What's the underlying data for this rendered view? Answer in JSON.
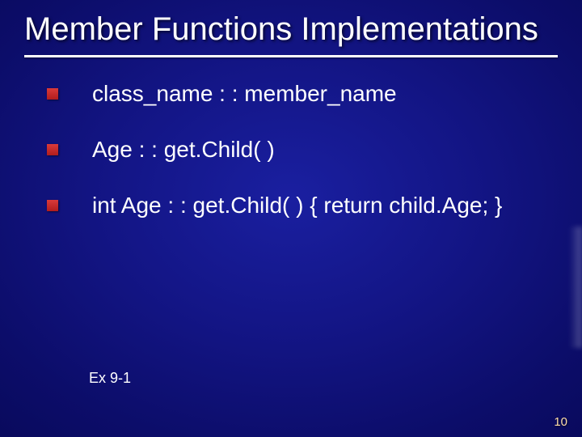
{
  "title": "Member Functions Implementations",
  "bullets": [
    "class_name   : :  member_name",
    "Age : : get.Child( )",
    "int  Age  : : get.Child( )       {  return child.Age;  }"
  ],
  "exref": "Ex 9-1",
  "page_number": "10"
}
